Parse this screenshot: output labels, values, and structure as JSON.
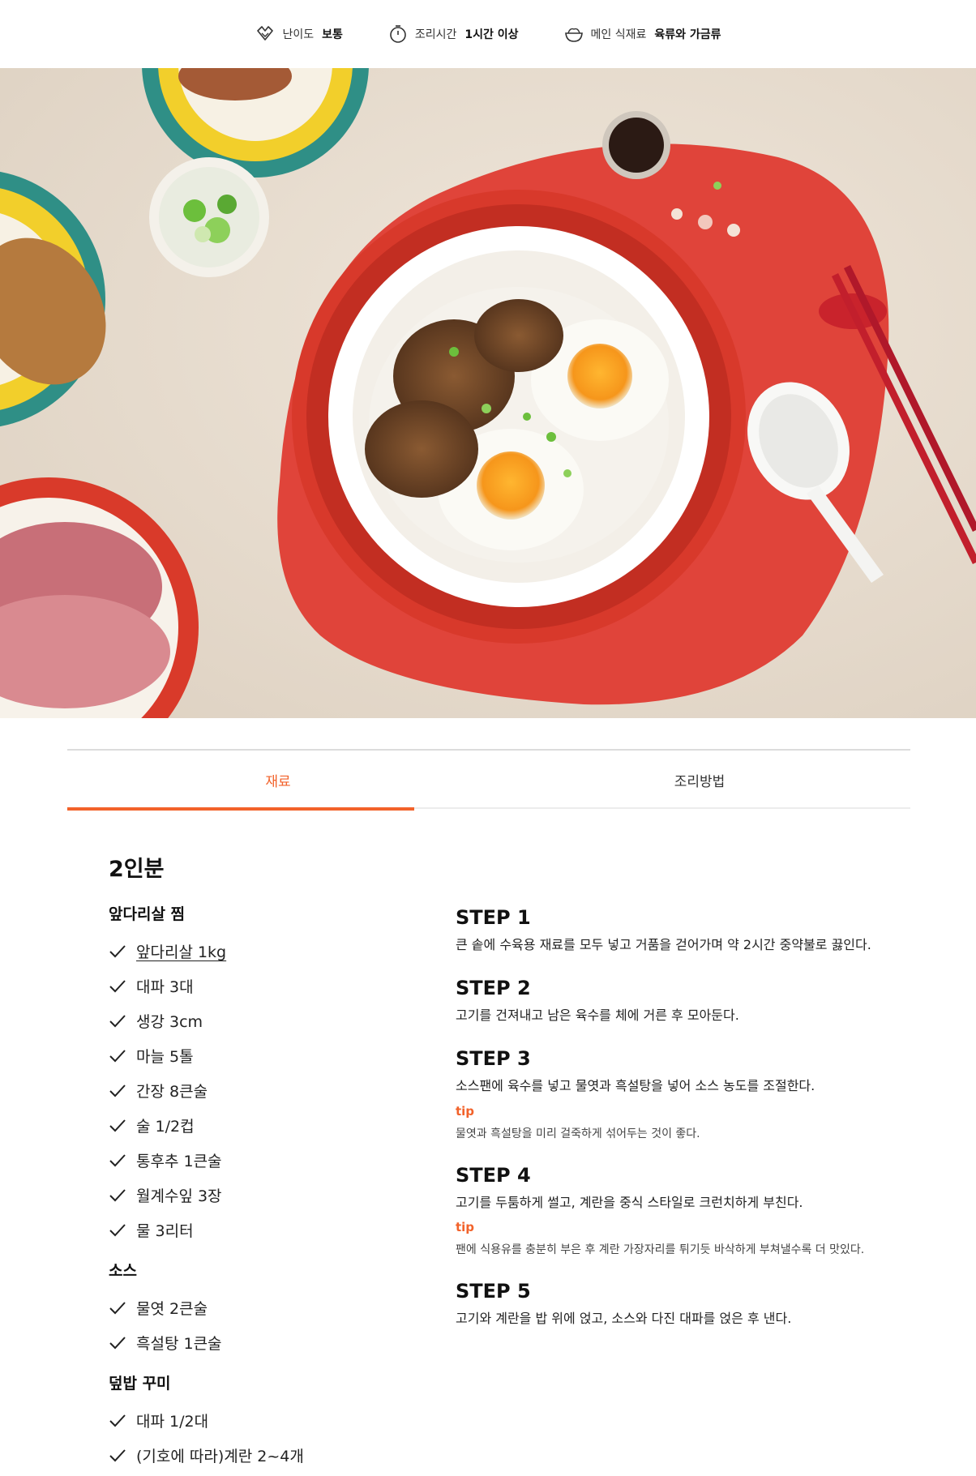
{
  "meta": {
    "difficulty": {
      "icon": "hands-icon",
      "label": "난이도",
      "value": "보통"
    },
    "time": {
      "icon": "timer-icon",
      "label": "조리시간",
      "value": "1시간 이상"
    },
    "main_ingredient": {
      "icon": "bowl-icon",
      "label": "메인 식재료",
      "value": "육류와 가금류"
    }
  },
  "hero": {
    "image": "braised-pork-rice-photo"
  },
  "tabs": [
    {
      "label": "재료",
      "active": true
    },
    {
      "label": "조리방법",
      "active": false
    }
  ],
  "ingredients": {
    "servings": "2인분",
    "groups": [
      {
        "title": "앞다리살 찜",
        "items": [
          "앞다리살 1kg",
          "대파 3대",
          "생강 3cm",
          "마늘 5톨",
          "간장 8큰술",
          "술 1/2컵",
          "통후추 1큰술",
          "월계수잎 3장",
          "물 3리터"
        ]
      },
      {
        "title": "소스",
        "items": [
          "물엿 2큰술",
          "흑설탕 1큰술"
        ]
      },
      {
        "title": "덮밥 꾸미",
        "items": [
          "대파 1/2대",
          "(기호에 따라)계란 2~4개"
        ]
      }
    ]
  },
  "steps": [
    {
      "title": "STEP 1",
      "desc": "큰 솥에 수육용 재료를 모두 넣고 거품을 걷어가며 약 2시간 중약불로 끓인다."
    },
    {
      "title": "STEP 2",
      "desc": "고기를 건져내고 남은 육수를 체에 거른 후 모아둔다."
    },
    {
      "title": "STEP 3",
      "desc": "소스팬에 육수를 넣고 물엿과 흑설탕을 넣어 소스 농도를 조절한다.",
      "tip_label": "tip",
      "tip": "물엿과 흑설탕을 미리 걸죽하게 섞어두는 것이 좋다."
    },
    {
      "title": "STEP 4",
      "desc": "고기를 두툼하게 썰고, 계란을 중식 스타일로 크런치하게 부친다.",
      "tip_label": "tip",
      "tip": "팬에 식용유를 충분히 부은 후 계란 가장자리를 튀기듯 바삭하게 부쳐낼수록 더 맛있다."
    },
    {
      "title": "STEP 5",
      "desc": "고기와 계란을 밥 위에 얹고, 소스와 다진 대파를 얹은 후 낸다."
    }
  ],
  "colors": {
    "accent": "#f2622a",
    "placemat": "#e0443a"
  }
}
